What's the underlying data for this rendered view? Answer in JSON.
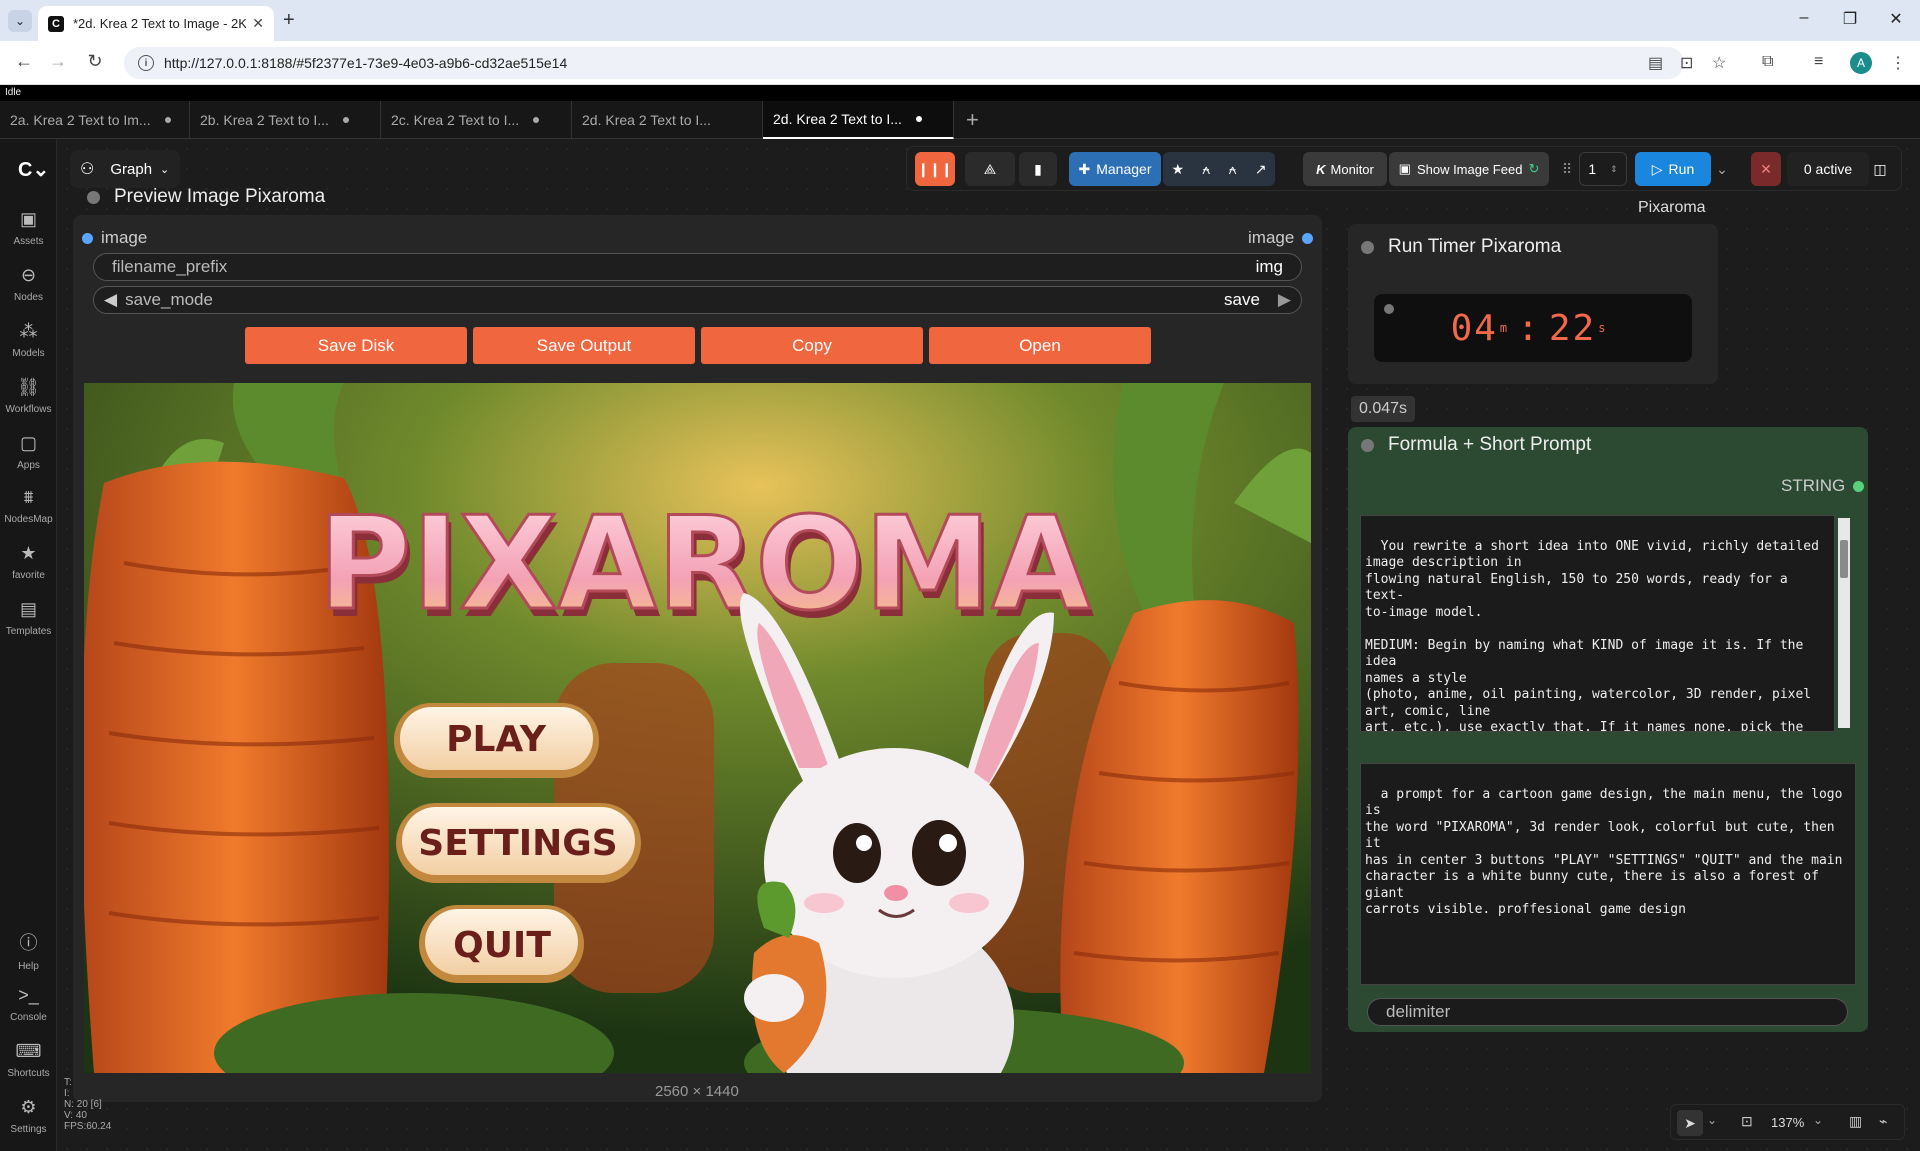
{
  "browser": {
    "tab_title": "*2d. Krea 2 Text to Image - 2K",
    "url": "http://127.0.0.1:8188/#5f2377e1-73e9-4e03-a9b6-cd32ae515e14"
  },
  "app": {
    "status": "Idle",
    "workflow_tabs": [
      {
        "label": "2a. Krea 2 Text to Im..."
      },
      {
        "label": "2b. Krea 2 Text to I..."
      },
      {
        "label": "2c. Krea 2 Text to I..."
      },
      {
        "label": "2d. Krea 2 Text to I..."
      },
      {
        "label": "2d. Krea 2 Text to I..."
      }
    ],
    "sidebar": [
      {
        "label": "Assets",
        "icon": "assets-icon"
      },
      {
        "label": "Nodes",
        "icon": "nodes-icon"
      },
      {
        "label": "Models",
        "icon": "models-icon"
      },
      {
        "label": "Workflows",
        "icon": "workflows-icon"
      },
      {
        "label": "Apps",
        "icon": "apps-icon"
      },
      {
        "label": "NodesMap",
        "icon": "nodesmap-icon"
      },
      {
        "label": "favorite",
        "icon": "star-icon"
      },
      {
        "label": "Templates",
        "icon": "templates-icon"
      },
      {
        "label": "Help",
        "icon": "help-icon"
      },
      {
        "label": "Console",
        "icon": "console-icon"
      },
      {
        "label": "Shortcuts",
        "icon": "keyboard-icon"
      },
      {
        "label": "Settings",
        "icon": "gear-icon"
      }
    ],
    "graph_label": "Graph",
    "toolbar": {
      "manager": "Manager",
      "monitor": "Monitor",
      "image_feed": "Show Image Feed",
      "queue_count": "1",
      "run": "Run",
      "active": "0 active",
      "pixaroma_label": "Pixaroma"
    },
    "preview_node": {
      "title": "Preview Image Pixaroma",
      "input_label": "image",
      "output_label": "image",
      "filename_prefix_label": "filename_prefix",
      "filename_prefix_value": "img",
      "save_mode_label": "save_mode",
      "save_mode_value": "save",
      "buttons": [
        "Save Disk",
        "Save Output",
        "Copy",
        "Open"
      ],
      "image_title": "PIXAROMA",
      "image_menu": [
        "PLAY",
        "SETTINGS",
        "QUIT"
      ],
      "dimensions": "2560 × 1440"
    },
    "timer_node": {
      "title": "Run Timer Pixaroma",
      "minutes": "04",
      "seconds": "22",
      "min_unit": "m",
      "sec_unit": "s"
    },
    "exec_time": "0.047s",
    "formula_node": {
      "title": "Formula + Short Prompt",
      "output": "STRING",
      "system_text": "You rewrite a short idea into ONE vivid, richly detailed\nimage description in\nflowing natural English, 150 to 250 words, ready for a text-\nto-image model.\n\nMEDIUM: Begin by naming what KIND of image it is. If the idea\nnames a style\n(photo, anime, oil painting, watercolor, 3D render, pixel\nart, comic, line\nart, etc.), use exactly that. If it names none, pick the best\nfit: for real\npeople, places, objects, or any true-to-life scene, make it a\nrealistic",
      "prompt_text": "a prompt for a cartoon game design, the main menu, the logo is\nthe word \"PIXAROMA\", 3d render look, colorful but cute, then it\nhas in center 3 buttons \"PLAY\" \"SETTINGS\" \"QUIT\" and the main\ncharacter is a white bunny cute, there is also a forest of giant\ncarrots visible. proffesional game design",
      "delimiter_label": "delimiter"
    },
    "stats": {
      "line1": "T:",
      "line2": "I:",
      "line3": "N: 20 [6]",
      "line4": "V: 40",
      "line5": "FPS:60.24"
    },
    "zoom": "137%"
  }
}
